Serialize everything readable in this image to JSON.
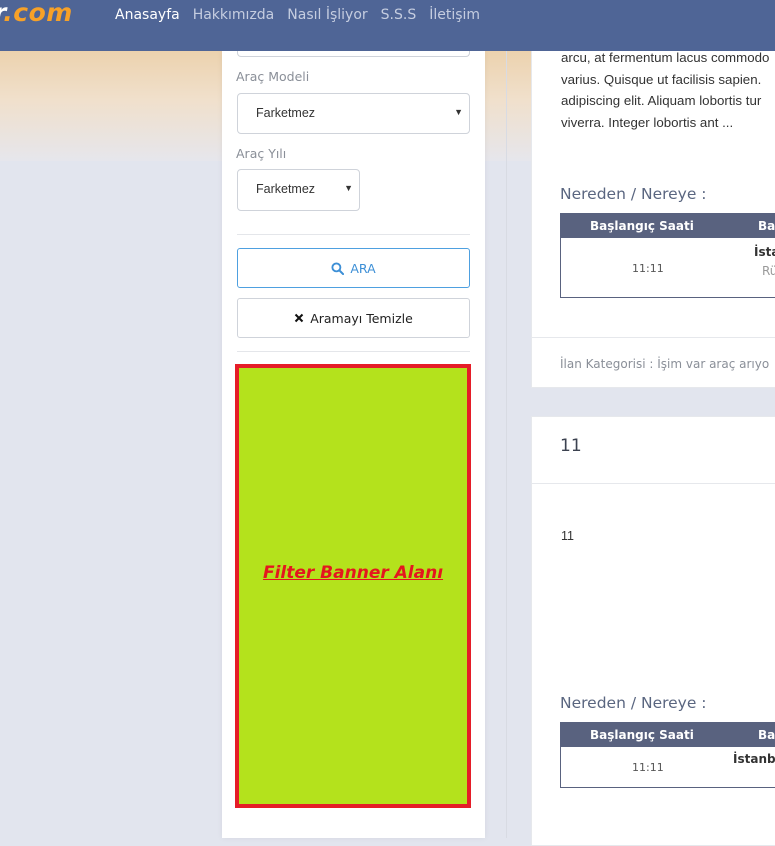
{
  "logo": {
    "part1": "r",
    "part2": ".com"
  },
  "nav": {
    "items": [
      {
        "label": "Anasayfa",
        "active": true
      },
      {
        "label": "Hakkımızda",
        "active": false
      },
      {
        "label": "Nasıl İşliyor",
        "active": false
      },
      {
        "label": "S.S.S",
        "active": false
      },
      {
        "label": "İletişim",
        "active": false
      }
    ]
  },
  "filter": {
    "model_label": "Araç Modeli",
    "model_value": "Farketmez",
    "year_label": "Araç Yılı",
    "year_value": "Farketmez",
    "search_button": "ARA",
    "clear_button": "Aramayı Temizle",
    "banner_text": "Filter Banner Alanı"
  },
  "listings": [
    {
      "description_lines": [
        "arcu, at fermentum lacus commodo",
        "varius. Quisque ut facilisis sapien.",
        "adipiscing elit. Aliquam lobortis tur",
        "viverra. Integer lobortis ant ..."
      ],
      "route_title": "Nereden / Nereye :",
      "table_headers": [
        "Başlangıç Saati",
        "Ba"
      ],
      "time": "11:11",
      "place": "İsta",
      "place_sub": "Rü",
      "category": "İlan Kategorisi : İşim var araç arıyo"
    },
    {
      "title": "11",
      "body": "11",
      "route_title": "Nereden / Nereye :",
      "table_headers": [
        "Başlangıç Saati",
        "Ba"
      ],
      "time": "11:11",
      "place": "İstanb"
    }
  ],
  "colors": {
    "navbar": "#4f6596",
    "logo_accent": "#f7a128",
    "banner_bg": "#b4e21c",
    "banner_border": "#e51d28",
    "search_button": "#3d8fd6",
    "table_header": "#59627f"
  },
  "icons": {
    "search": "search-icon",
    "clear": "close-icon"
  }
}
